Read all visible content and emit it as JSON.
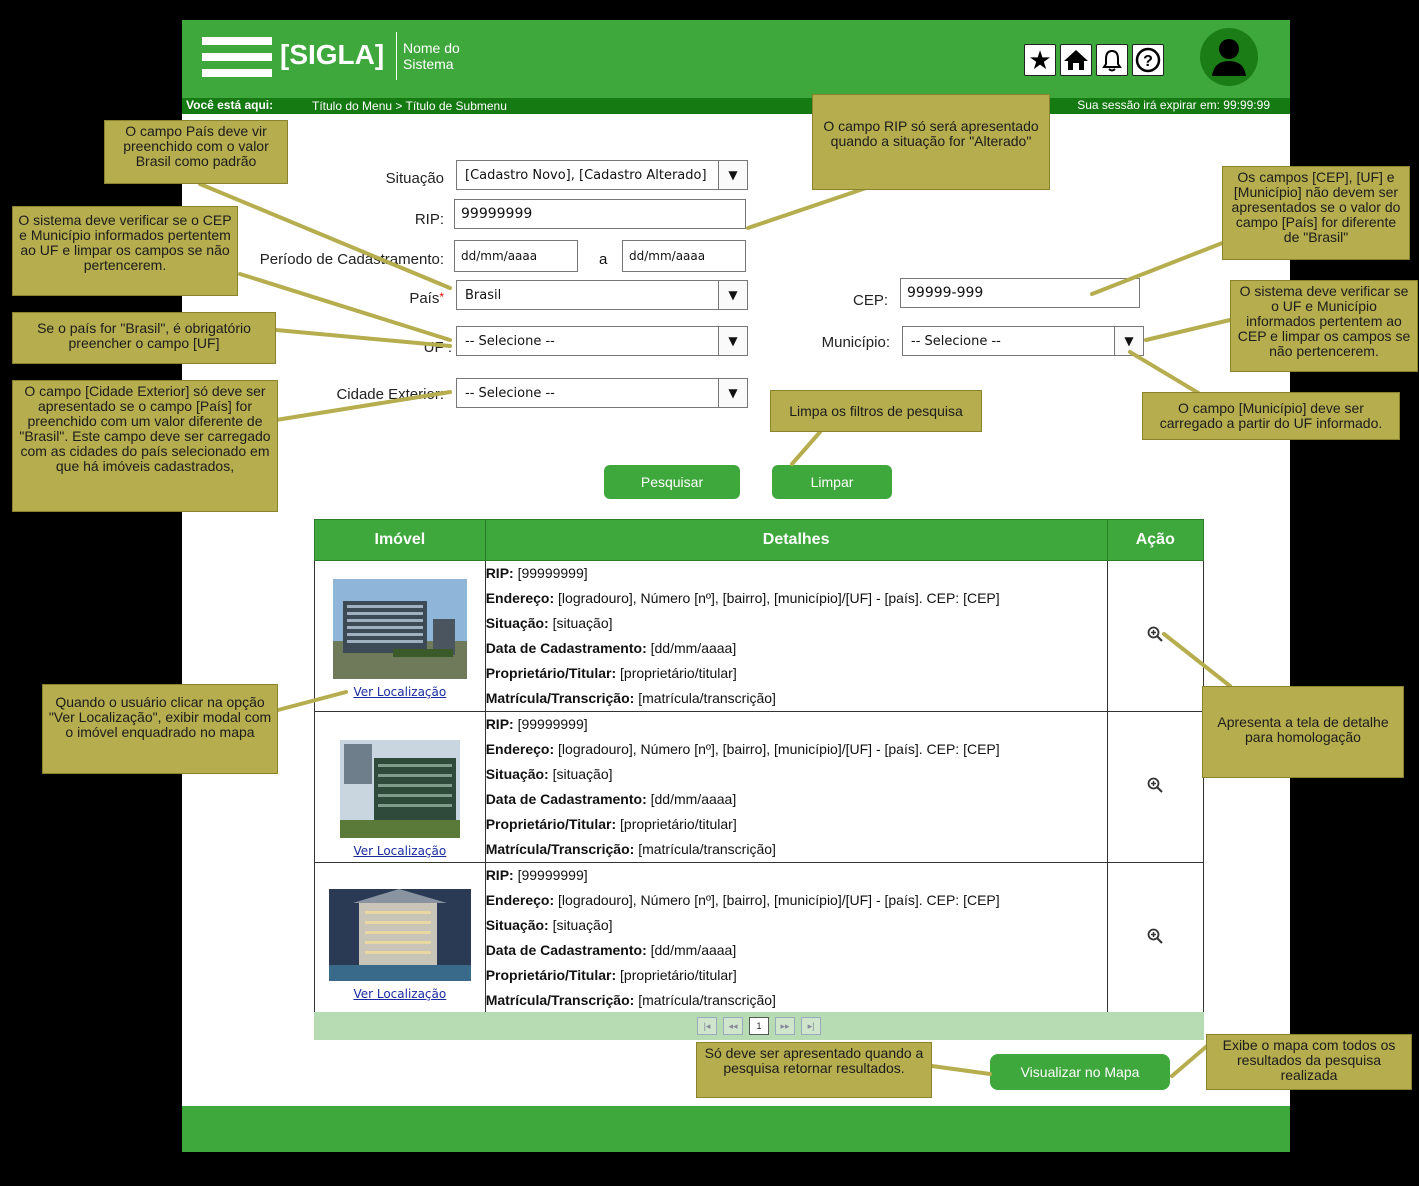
{
  "header": {
    "sigla": "[SIGLA]",
    "system_name_line1": "Nome do",
    "system_name_line2": "Sistema",
    "icons": [
      "star-icon",
      "home-icon",
      "bell-icon",
      "help-icon",
      "user-icon"
    ]
  },
  "breadcrumb": {
    "label": "Você está aqui:",
    "path": "Título do Menu > Título de Submenu",
    "session": "Sua sessão irá expirar em: 99:99:99"
  },
  "form": {
    "situacao_label": "Situação",
    "situacao_value": "[Cadastro Novo], [Cadastro Alterado]",
    "rip_label": "RIP:",
    "rip_value": "99999999",
    "periodo_label": "Período de Cadastramento:",
    "periodo_from": "dd/mm/aaaa",
    "periodo_sep": "a",
    "periodo_to": "dd/mm/aaaa",
    "pais_label": "País",
    "pais_required": "*",
    "pais_value": "Brasil",
    "cep_label": "CEP:",
    "cep_value": "99999-999",
    "uf_label": "UF :",
    "uf_value": "-- Selecione --",
    "municipio_label": "Município:",
    "municipio_value": "-- Selecione --",
    "cidade_label": "Cidade Exterior:",
    "cidade_value": "-- Selecione --",
    "pesquisar": "Pesquisar",
    "limpar": "Limpar"
  },
  "table": {
    "headers": [
      "Imóvel",
      "Detalhes",
      "Ação"
    ],
    "link_label": "Ver Localização",
    "detail_labels": {
      "rip": "RIP:",
      "endereco": "Endereço:",
      "situacao": "Situação:",
      "data": "Data de Cadastramento:",
      "proprietario": "Proprietário/Titular:",
      "matricula": "Matrícula/Transcrição:"
    },
    "rows": [
      {
        "rip": "[99999999]",
        "endereco": "[logradouro], Número [nº], [bairro], [município]/[UF] - [país]. CEP: [CEP]",
        "situacao": "[situação]",
        "data": "[dd/mm/aaaa]",
        "proprietario": "[proprietário/titular]",
        "matricula": "[matrícula/transcrição]"
      },
      {
        "rip": "[99999999]",
        "endereco": "[logradouro], Número [nº], [bairro], [município]/[UF] - [país]. CEP: [CEP]",
        "situacao": "[situação]",
        "data": "[dd/mm/aaaa]",
        "proprietario": "[proprietário/titular]",
        "matricula": "[matrícula/transcrição]"
      },
      {
        "rip": "[99999999]",
        "endereco": "[logradouro], Número [nº], [bairro], [município]/[UF] - [país]. CEP: [CEP]",
        "situacao": "[situação]",
        "data": "[dd/mm/aaaa]",
        "proprietario": "[proprietário/titular]",
        "matricula": "[matrícula/transcrição]"
      }
    ]
  },
  "pager": {
    "first": "|◂",
    "prev": "◂◂",
    "current": "1",
    "next": "▸▸",
    "last": "▸|"
  },
  "map_button": "Visualizar no Mapa",
  "notes": {
    "pais": "O campo País deve vir preenchido com o valor Brasil como padrão",
    "rip": "O campo RIP só será apresentado quando a situação for \"Alterado\"",
    "cep_mun": "O sistema deve verificar se o CEP e Município informados pertentem ao UF e limpar os campos se não pertencerem.",
    "uf": "Se o país for \"Brasil\", é obrigatório preencher o campo [UF]",
    "cidade": "O campo [Cidade Exterior] só deve ser apresentado se o campo [País] for preenchido com um valor diferente de \"Brasil\". Este campo deve ser carregado com as cidades do país selecionado em que há imóveis cadastrados,",
    "campos": "Os campos [CEP], [UF] e [Município] não devem ser apresentados se o valor do campo [País] for diferente de \"Brasil\"",
    "uf_mun": "O sistema deve verificar se o UF e Município informados pertentem ao CEP e limpar os campos se não pertencerem.",
    "municipio": "O campo [Município] deve ser carregado a partir do UF informado.",
    "limpa": "Limpa os filtros de pesquisa",
    "localizacao": "Quando o usuário clicar na opção \"Ver Localização\", exibir modal com o imóvel enquadrado no mapa",
    "detalhe": "Apresenta a tela de detalhe para homologação",
    "so_deve": "Só deve ser apresentado quando a pesquisa retornar resultados.",
    "exibe_mapa": "Exibe o mapa com todos os resultados da pesquisa realizada"
  }
}
